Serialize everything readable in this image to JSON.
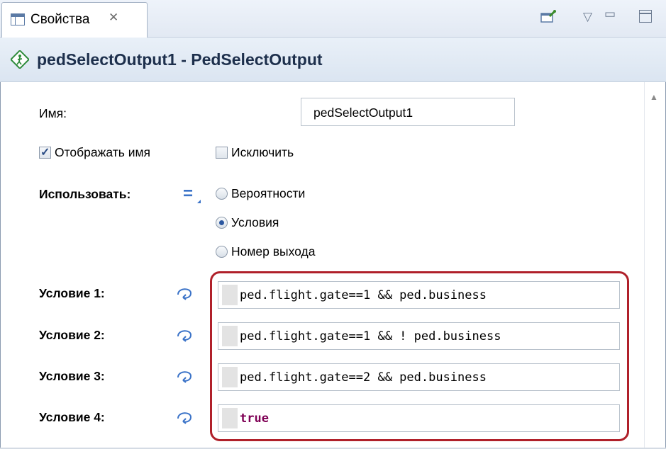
{
  "tab": {
    "title": "Свойства",
    "close_glyph": "✕",
    "icon": "properties-icon"
  },
  "toolbar": {
    "pin_icon": "pin-icon",
    "menu_glyph": "▽",
    "minimize_glyph": "▭",
    "maximize_icon": "maximize-icon"
  },
  "header": {
    "title": "pedSelectOutput1 - PedSelectOutput",
    "icon": "ped-select-output-icon"
  },
  "form": {
    "name_label": "Имя:",
    "name_value": "pedSelectOutput1",
    "show_name": {
      "label": "Отображать имя",
      "checked": true
    },
    "exclude": {
      "label": "Исключить",
      "checked": false
    },
    "use_label": "Использовать:",
    "use_options": [
      {
        "label": "Вероятности",
        "selected": false
      },
      {
        "label": "Условия",
        "selected": true
      },
      {
        "label": "Номер выхода",
        "selected": false
      }
    ],
    "conditions": [
      {
        "label": "Условие 1:",
        "value": "ped.flight.gate==1 && ped.business"
      },
      {
        "label": "Условие 2:",
        "value": "ped.flight.gate==1 && ! ped.business"
      },
      {
        "label": "Условие 3:",
        "value": "ped.flight.gate==2 && ped.business"
      },
      {
        "label": "Условие 4:",
        "value": "true"
      }
    ]
  },
  "colors": {
    "highlight_border": "#b0202a",
    "header_title": "#1d2f4c",
    "keyword": "#7f0055",
    "accent": "#3b73c8"
  }
}
